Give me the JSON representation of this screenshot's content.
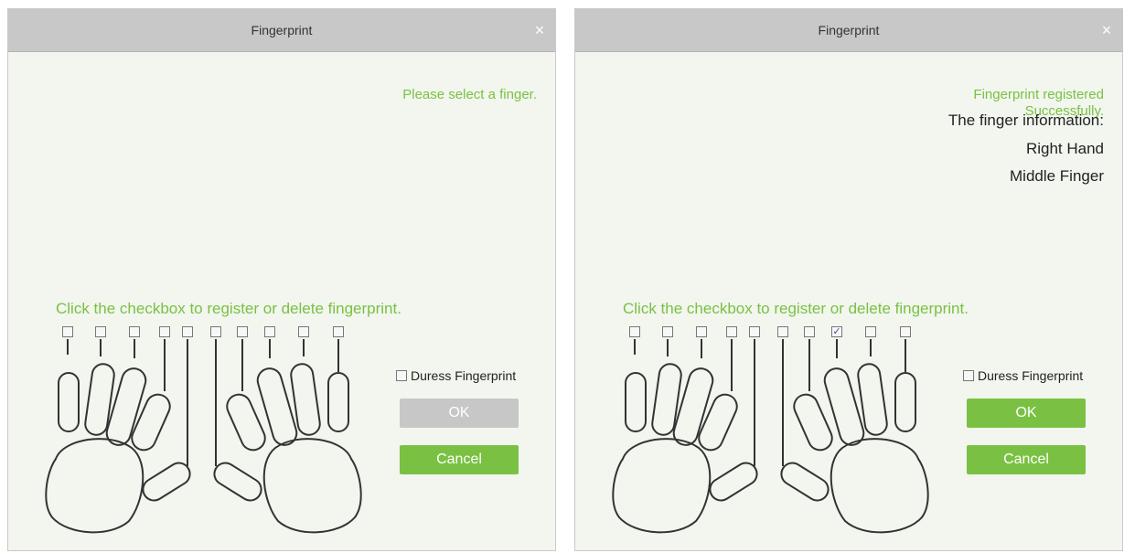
{
  "colors": {
    "accent": "#7ac143",
    "titlebar": "#c8c8c8",
    "body": "#f2f6ee",
    "disabled": "#c7c7c7"
  },
  "dialog_left": {
    "title": "Fingerprint",
    "close_icon": "×",
    "message": "Please select a finger.",
    "prompt": "Click the checkbox to register or delete fingerprint.",
    "finger_checkboxes": [
      "",
      "",
      "",
      "",
      "",
      "",
      "",
      "",
      "",
      ""
    ],
    "duress_label": "Duress Fingerprint",
    "ok_label": "OK",
    "ok_state": "disabled",
    "cancel_label": "Cancel"
  },
  "dialog_right": {
    "title": "Fingerprint",
    "close_icon": "×",
    "message_line1": "Fingerprint registered",
    "message_line2": "Successfully.",
    "info_label": "The finger information:",
    "info_hand": "Right Hand",
    "info_finger": "Middle Finger",
    "prompt": "Click the checkbox to register or delete fingerprint.",
    "finger_checkboxes": [
      "",
      "",
      "",
      "",
      "",
      "",
      "",
      "✓",
      "",
      ""
    ],
    "duress_label": "Duress Fingerprint",
    "ok_label": "OK",
    "ok_state": "enabled",
    "cancel_label": "Cancel"
  }
}
